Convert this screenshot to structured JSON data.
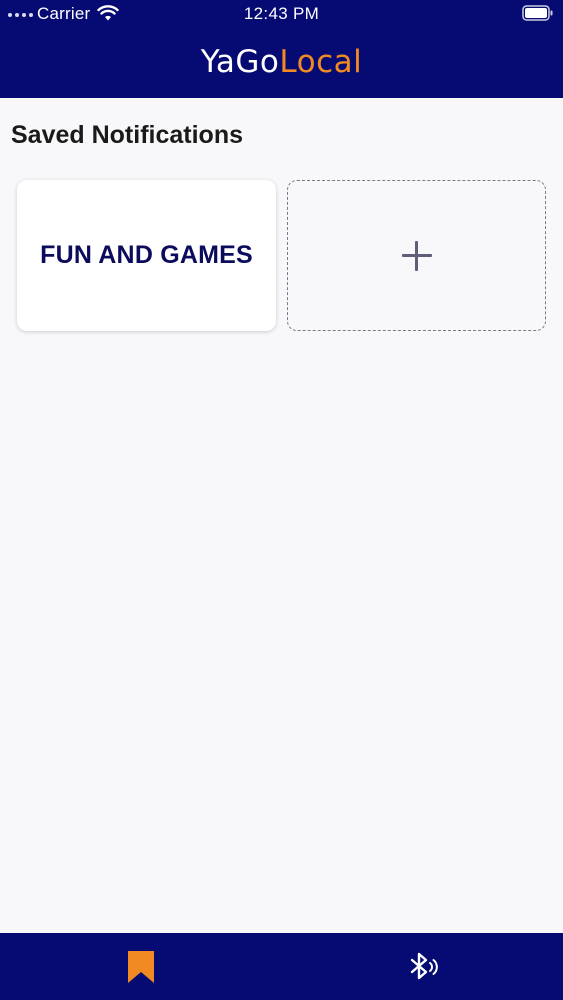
{
  "status_bar": {
    "carrier": "Carrier",
    "time": "12:43 PM"
  },
  "header": {
    "logo_part1": "YaGo",
    "logo_part2": "Local"
  },
  "main": {
    "title": "Saved Notifications",
    "cards": [
      {
        "label": "FUN AND GAMES"
      }
    ],
    "add_card_icon": "plus-icon"
  },
  "tab_bar": {
    "tabs": [
      {
        "icon": "bookmark-icon",
        "active": true
      },
      {
        "icon": "bluetooth-icon",
        "active": false
      }
    ]
  },
  "colors": {
    "header_bg": "#060a73",
    "accent": "#f28a24",
    "card_text": "#0b0d5c",
    "background": "#f8f8fa"
  }
}
